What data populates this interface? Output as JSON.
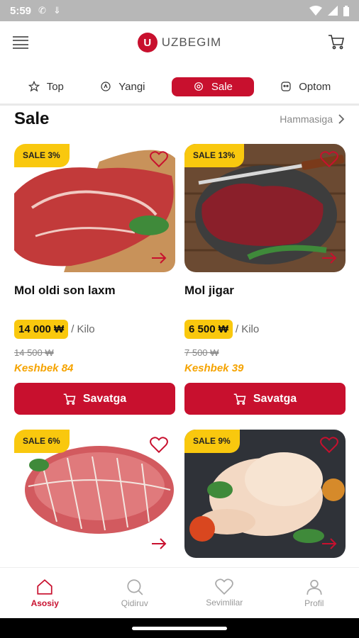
{
  "status_bar": {
    "time": "5:59"
  },
  "app": {
    "logo_letter": "U",
    "name": "UZBEGIM"
  },
  "tabs": [
    {
      "label": "Top",
      "icon": "star-icon"
    },
    {
      "label": "Yangi",
      "icon": "new-badge-icon"
    },
    {
      "label": "Sale",
      "icon": "sale-gear-icon",
      "active": true
    },
    {
      "label": "Optom",
      "icon": "wholesale-icon"
    }
  ],
  "section": {
    "title": "Sale",
    "see_all": "Hammasiga"
  },
  "products": [
    {
      "badge": "SALE 3%",
      "name": "Mol oldi son laxm",
      "price": "14 000 ₩",
      "unit": "/ Kilo",
      "old_price": "14 500 ₩",
      "cashback": "Keshbek 84",
      "button": "Savatga",
      "image": "raw beef steak on board"
    },
    {
      "badge": "SALE 13%",
      "name": "Mol jigar",
      "price": "6 500 ₩",
      "unit": "/ Kilo",
      "old_price": "7 500 ₩",
      "cashback": "Keshbek 39",
      "button": "Savatga",
      "image": "beef liver with knife"
    },
    {
      "badge": "SALE 6%",
      "image": "tied beef roast"
    },
    {
      "badge": "SALE 9%",
      "image": "whole raw chicken"
    }
  ],
  "bottom_nav": [
    {
      "label": "Asosiy",
      "icon": "home-icon",
      "active": true
    },
    {
      "label": "Qidiruv",
      "icon": "search-icon"
    },
    {
      "label": "Sevimlilar",
      "icon": "heart-icon"
    },
    {
      "label": "Profil",
      "icon": "profile-icon"
    }
  ],
  "colors": {
    "brand_red": "#c8102e",
    "badge_yellow": "#f9c80e",
    "cashback_orange": "#f5a300"
  }
}
